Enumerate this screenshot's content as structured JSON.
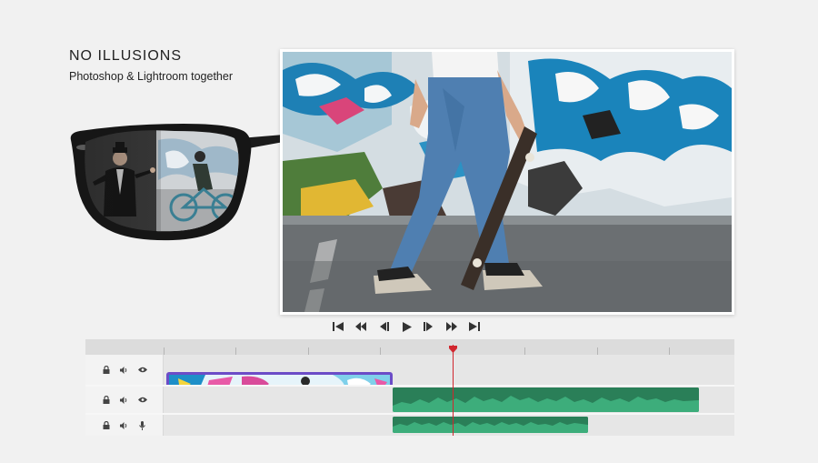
{
  "headline": {
    "title": "NO ILLUSIONS",
    "subtitle": "Photoshop & Lightroom together"
  },
  "transport": {
    "controls": [
      "skip-to-start",
      "previous-frame",
      "step-back",
      "play",
      "step-forward",
      "next-frame",
      "skip-to-end"
    ]
  },
  "timeline": {
    "tracks": [
      {
        "kind": "video",
        "icons": [
          "lock-icon",
          "speaker-icon",
          "eye-icon"
        ]
      },
      {
        "kind": "audio",
        "icons": [
          "lock-icon",
          "speaker-icon",
          "eye-icon"
        ]
      },
      {
        "kind": "voice",
        "icons": [
          "lock-icon",
          "speaker-icon",
          "microphone-icon"
        ]
      }
    ]
  },
  "colors": {
    "background": "#f1f1f1",
    "video_clip_border": "#6b4cc7",
    "audio_clip": "#3aa877",
    "playhead": "#d1262e"
  }
}
